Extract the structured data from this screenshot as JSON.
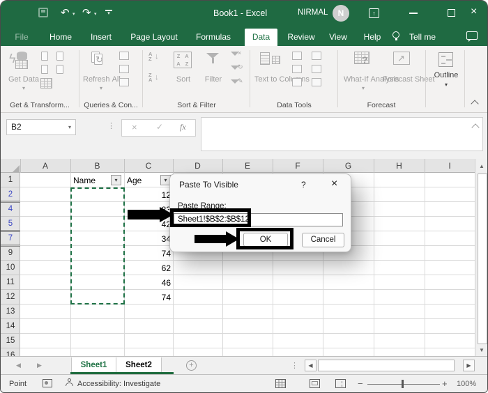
{
  "window": {
    "title": "Book1 - Excel",
    "user": "NIRMAL",
    "avatar_initial": "N"
  },
  "colors": {
    "excel_green": "#217346",
    "titlebar_green": "#1f6a42",
    "marquee_green": "#1d7044",
    "filtered_row_blue": "#3a45c3",
    "annotation_black": "#000000"
  },
  "icons": {
    "save": "save-disk",
    "undo": "↶",
    "redo": "↷",
    "dropdown": "▾",
    "minimize": "—",
    "close": "×",
    "cancel_x": "×",
    "check": "✓",
    "fx": "fx",
    "dots": "⋮",
    "scroll_up": "▲",
    "scroll_down": "▼",
    "scroll_left": "◀",
    "scroll_right": "▶",
    "add_sheet": "+",
    "zoom_in": "+",
    "zoom_out": "−",
    "help": "?",
    "restore_up": "↑",
    "refresh": "↻",
    "sort_a": "A",
    "sort_z": "Z",
    "arrow_down": "↓",
    "trend_up": "↗",
    "question": "?"
  },
  "menu": {
    "tabs": [
      "File",
      "Home",
      "Insert",
      "Page Layout",
      "Formulas",
      "Data",
      "Review",
      "View",
      "Help"
    ],
    "active_tab": "Data",
    "tell_me": "Tell me"
  },
  "ribbon": {
    "groups": [
      "Get & Transform...",
      "Queries & Con...",
      "Sort & Filter",
      "Data Tools",
      "Forecast"
    ],
    "get_data": "Get Data",
    "refresh_all": "Refresh All",
    "sort": "Sort",
    "filter": "Filter",
    "text_to_columns": "Text to Columns",
    "what_if": "What-If Analysis",
    "forecast_sheet": "Forecast Sheet",
    "outline": "Outline"
  },
  "formula_bar": {
    "name_box": "B2",
    "formula_value": ""
  },
  "grid": {
    "columns": [
      "A",
      "B",
      "C",
      "D",
      "E",
      "F",
      "G",
      "H",
      "I"
    ],
    "headers": {
      "name": "Name",
      "age": "Age"
    },
    "rows": [
      {
        "num": "1"
      },
      {
        "num": "2",
        "age": "12"
      },
      {
        "num": "4",
        "age": "83"
      },
      {
        "num": "5",
        "age": "42"
      },
      {
        "num": "7",
        "age": "34"
      },
      {
        "num": "9",
        "age": "74"
      },
      {
        "num": "10",
        "age": "62"
      },
      {
        "num": "11",
        "age": "46"
      },
      {
        "num": "12",
        "age": "74"
      },
      {
        "num": "13"
      },
      {
        "num": "14"
      },
      {
        "num": "15"
      },
      {
        "num": "16"
      }
    ]
  },
  "dialog": {
    "title": "Paste To Visible",
    "paste_range_label": "Paste Range:",
    "paste_range_value": "Sheet1!$B$2:$B$12",
    "ok": "OK",
    "cancel": "Cancel"
  },
  "sheets": {
    "tabs": [
      "Sheet1",
      "Sheet2"
    ]
  },
  "status": {
    "mode": "Point",
    "accessibility": "Accessibility: Investigate",
    "zoom": "100%"
  }
}
